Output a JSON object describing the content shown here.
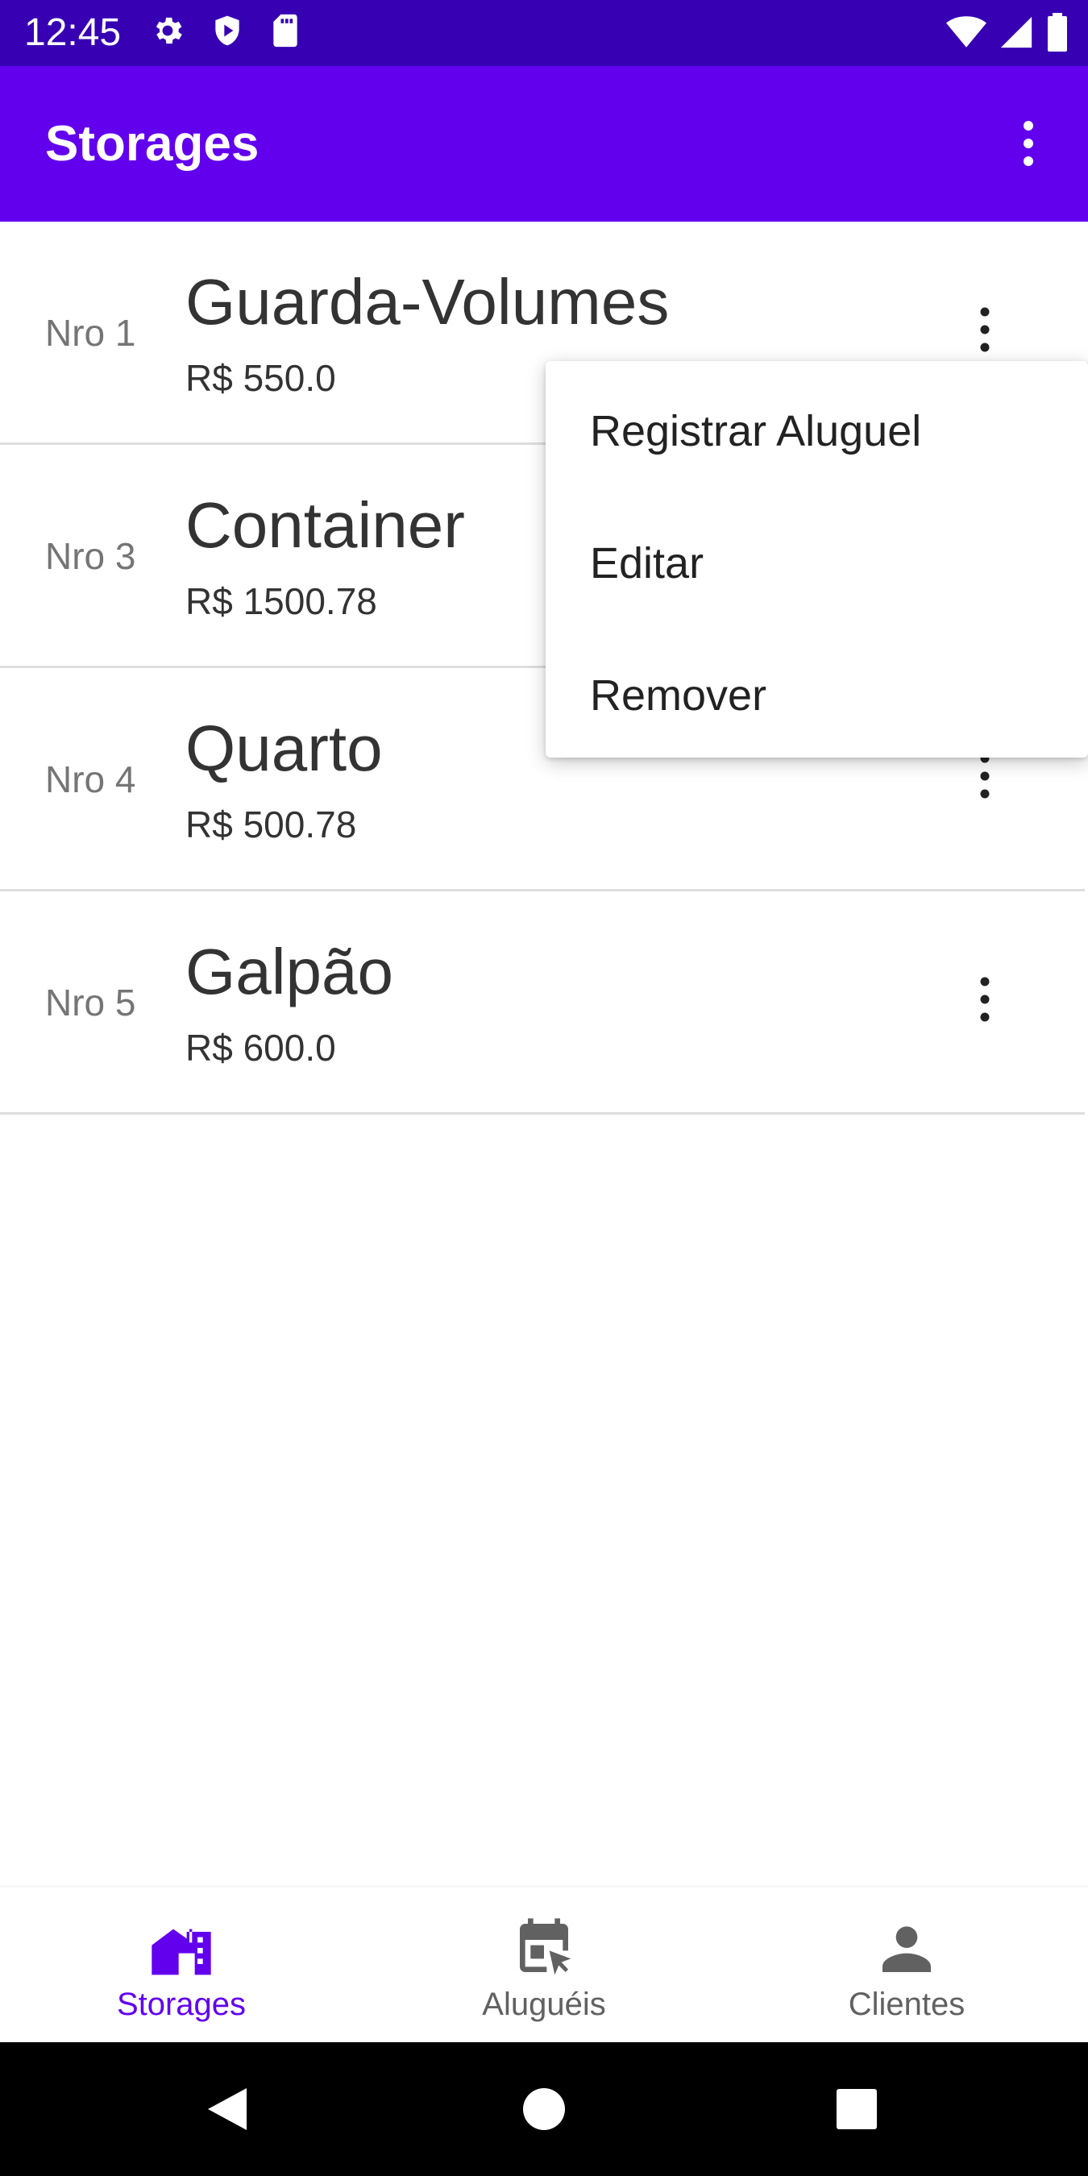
{
  "status_bar": {
    "time": "12:45",
    "left_icons": [
      "gear-icon",
      "shield-play-icon",
      "sd-card-icon"
    ],
    "right_icons": [
      "wifi-icon",
      "signal-icon",
      "battery-icon"
    ]
  },
  "app_bar": {
    "title": "Storages",
    "overflow_icon": "more-vert-icon"
  },
  "storages": [
    {
      "number": "Nro 1",
      "name": "Guarda-Volumes",
      "price": "R$ 550.0"
    },
    {
      "number": "Nro 3",
      "name": "Container",
      "price": "R$ 1500.78"
    },
    {
      "number": "Nro 4",
      "name": "Quarto",
      "price": "R$ 500.78"
    },
    {
      "number": "Nro 5",
      "name": "Galpão",
      "price": "R$ 600.0"
    }
  ],
  "popup_menu": {
    "items": [
      "Registrar Aluguel",
      "Editar",
      "Remover"
    ]
  },
  "bottom_nav": {
    "items": [
      {
        "label": "Storages",
        "icon": "storage-house-icon",
        "active": true
      },
      {
        "label": "Aluguéis",
        "icon": "calendar-click-icon",
        "active": false
      },
      {
        "label": "Clientes",
        "icon": "person-icon",
        "active": false
      }
    ]
  },
  "colors": {
    "status_bar": "#3700b3",
    "primary": "#6200ee",
    "nav_inactive": "#616161"
  }
}
